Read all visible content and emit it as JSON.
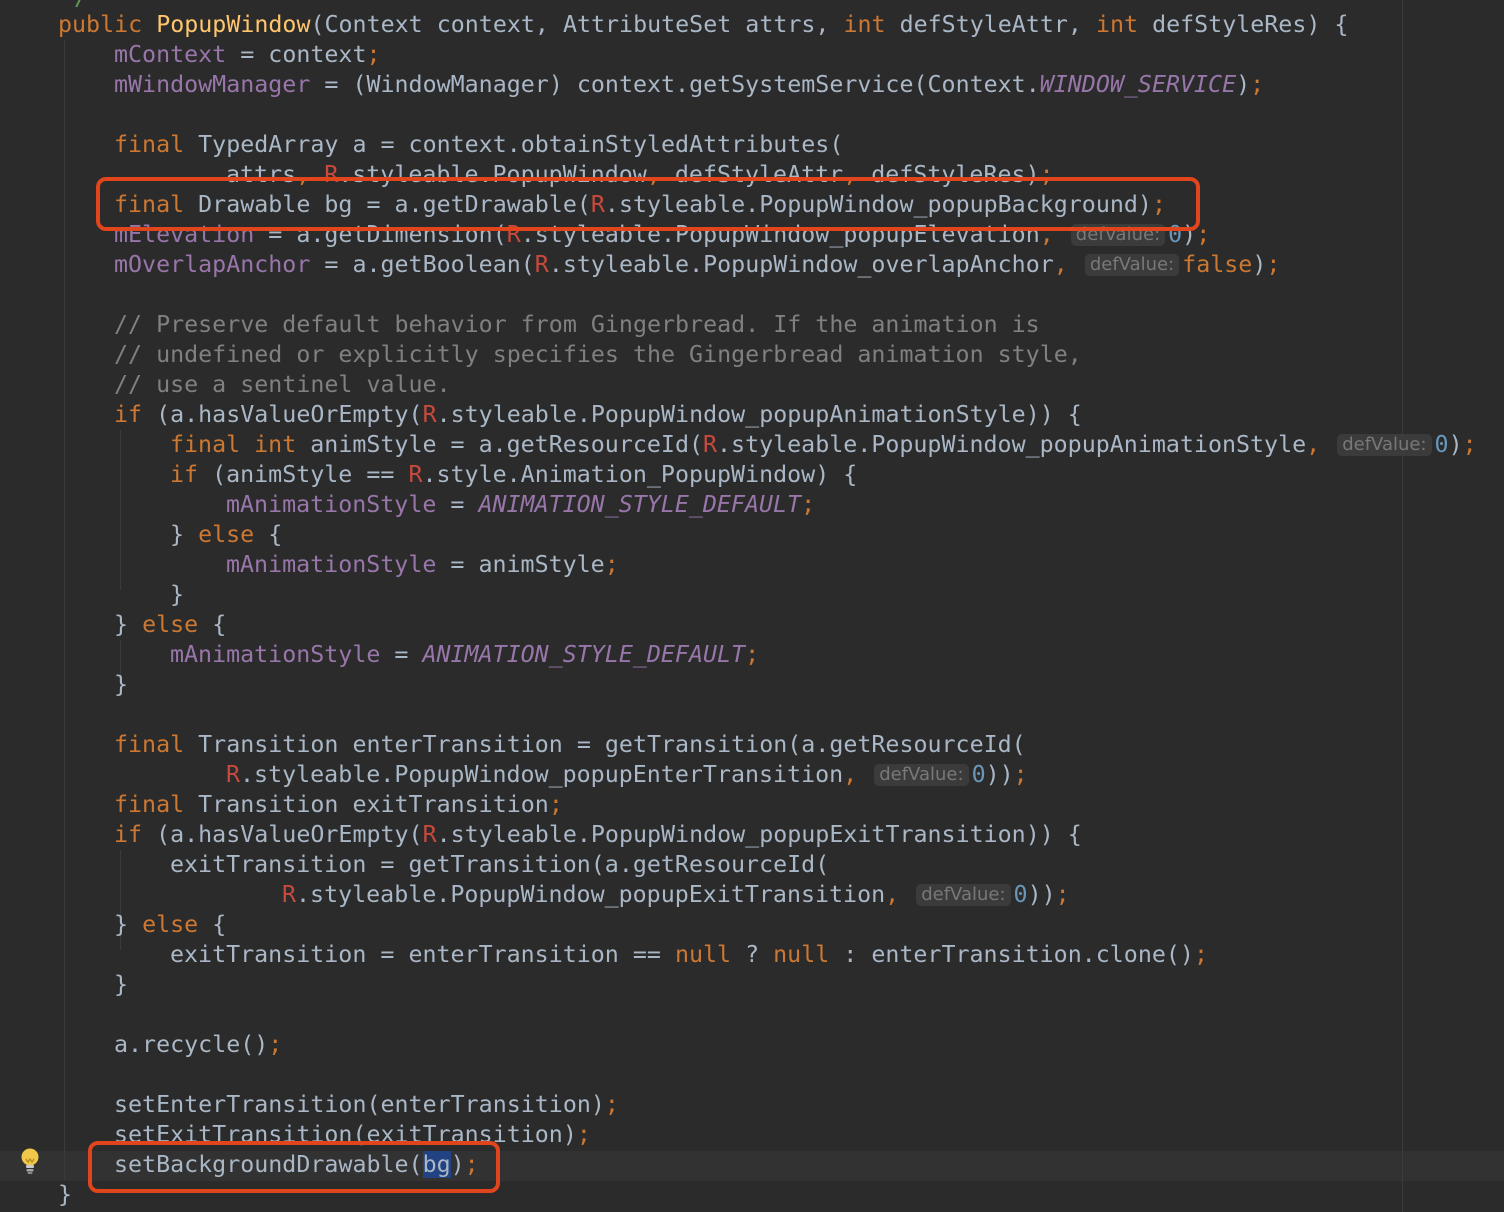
{
  "editor": {
    "top_partial": "*/",
    "lines": {
      "l0": {
        "a": "public ",
        "b": "PopupWindow",
        "c": "(Context context, AttributeSet attrs, ",
        "d": "int ",
        "e": "defStyleAttr, ",
        "f": "int ",
        "g": "defStyleRes) {"
      },
      "l1": {
        "a": "mContext",
        "b": " = context",
        "c": ";"
      },
      "l2": {
        "a": "mWindowManager",
        "b": " = (WindowManager) context.getSystemService(Context.",
        "c": "WINDOW_SERVICE",
        "d": ")",
        "e": ";"
      },
      "l4": {
        "a": "final ",
        "b": "TypedArray a = context.obtainStyledAttributes("
      },
      "l5": {
        "a": "attrs",
        "b": ", ",
        "c": "R",
        "d": ".styleable.PopupWindow",
        "e": ", ",
        "f": "defStyleAttr",
        "g": ", ",
        "h": "defStyleRes)",
        "i": ";"
      },
      "l6": {
        "a": "final ",
        "b": "Drawable bg = a.getDrawable(",
        "c": "R",
        "d": ".styleable.PopupWindow_popupBackground)",
        "e": ";"
      },
      "l7": {
        "a": "mElevation",
        "b": " = a.getDimension(",
        "c": "R",
        "d": ".styleable.PopupWindow_popupElevation",
        "e": ", ",
        "f": "defValue:",
        "g": "0",
        "h": ")",
        "i": ";"
      },
      "l8": {
        "a": "mOverlapAnchor",
        "b": " = a.getBoolean(",
        "c": "R",
        "d": ".styleable.PopupWindow_overlapAnchor",
        "e": ", ",
        "f": "defValue:",
        "g": "false",
        "h": ")",
        "i": ";"
      },
      "l10": "// Preserve default behavior from Gingerbread. If the animation is",
      "l11": "// undefined or explicitly specifies the Gingerbread animation style,",
      "l12": "// use a sentinel value.",
      "l13": {
        "a": "if ",
        "b": "(a.hasValueOrEmpty(",
        "c": "R",
        "d": ".styleable.PopupWindow_popupAnimationStyle)) {"
      },
      "l14": {
        "a": "final int ",
        "b": "animStyle = a.getResourceId(",
        "c": "R",
        "d": ".styleable.PopupWindow_popupAnimationStyle",
        "e": ", ",
        "f": "defValue:",
        "g": "0",
        "h": ")",
        "i": ";"
      },
      "l15": {
        "a": "if ",
        "b": "(animStyle == ",
        "c": "R",
        "d": ".style.Animation_PopupWindow) {"
      },
      "l16": {
        "a": "mAnimationStyle",
        "b": " = ",
        "c": "ANIMATION_STYLE_DEFAULT",
        "d": ";"
      },
      "l17": {
        "a": "} ",
        "b": "else ",
        "c": "{"
      },
      "l18": {
        "a": "mAnimationStyle",
        "b": " = animStyle",
        "c": ";"
      },
      "l19": "}",
      "l20": {
        "a": "} ",
        "b": "else ",
        "c": "{"
      },
      "l21": {
        "a": "mAnimationStyle",
        "b": " = ",
        "c": "ANIMATION_STYLE_DEFAULT",
        "d": ";"
      },
      "l22": "}",
      "l24": {
        "a": "final ",
        "b": "Transition enterTransition = getTransition(a.getResourceId("
      },
      "l25": {
        "a": "R",
        "b": ".styleable.PopupWindow_popupEnterTransition",
        "c": ", ",
        "d": "defValue:",
        "e": "0",
        "f": "))",
        "g": ";"
      },
      "l26": {
        "a": "final ",
        "b": "Transition exitTransition",
        "c": ";"
      },
      "l27": {
        "a": "if ",
        "b": "(a.hasValueOrEmpty(",
        "c": "R",
        "d": ".styleable.PopupWindow_popupExitTransition)) {"
      },
      "l28": {
        "a": "exitTransition = getTransition(a.getResourceId("
      },
      "l29": {
        "a": "R",
        "b": ".styleable.PopupWindow_popupExitTransition",
        "c": ", ",
        "d": "defValue:",
        "e": "0",
        "f": "))",
        "g": ";"
      },
      "l30": {
        "a": "} ",
        "b": "else ",
        "c": "{"
      },
      "l31": {
        "a": "exitTransition = enterTransition == ",
        "b": "null ",
        "c": "? ",
        "d": "null ",
        "e": ": enterTransition.clone()",
        "f": ";"
      },
      "l32": "}",
      "l34": {
        "a": "a.recycle()",
        "b": ";"
      },
      "l36": {
        "a": "setEnterTransition(enterTransition)",
        "b": ";"
      },
      "l37": {
        "a": "setExitTransition(exitTransition)",
        "b": ";"
      },
      "l38": {
        "a": "setBackgroundDrawable(",
        "b": "bg",
        "c": ")",
        "d": ";"
      },
      "l39": "}"
    }
  },
  "colors": {
    "background": "#2b2b2b",
    "keyword": "#cc7832",
    "field": "#9876aa",
    "function": "#ffc66d",
    "number": "#6897bb",
    "comment": "#808080",
    "highlight_box": "#e0451c"
  },
  "icons": {
    "gutter": "lightbulb-icon"
  }
}
